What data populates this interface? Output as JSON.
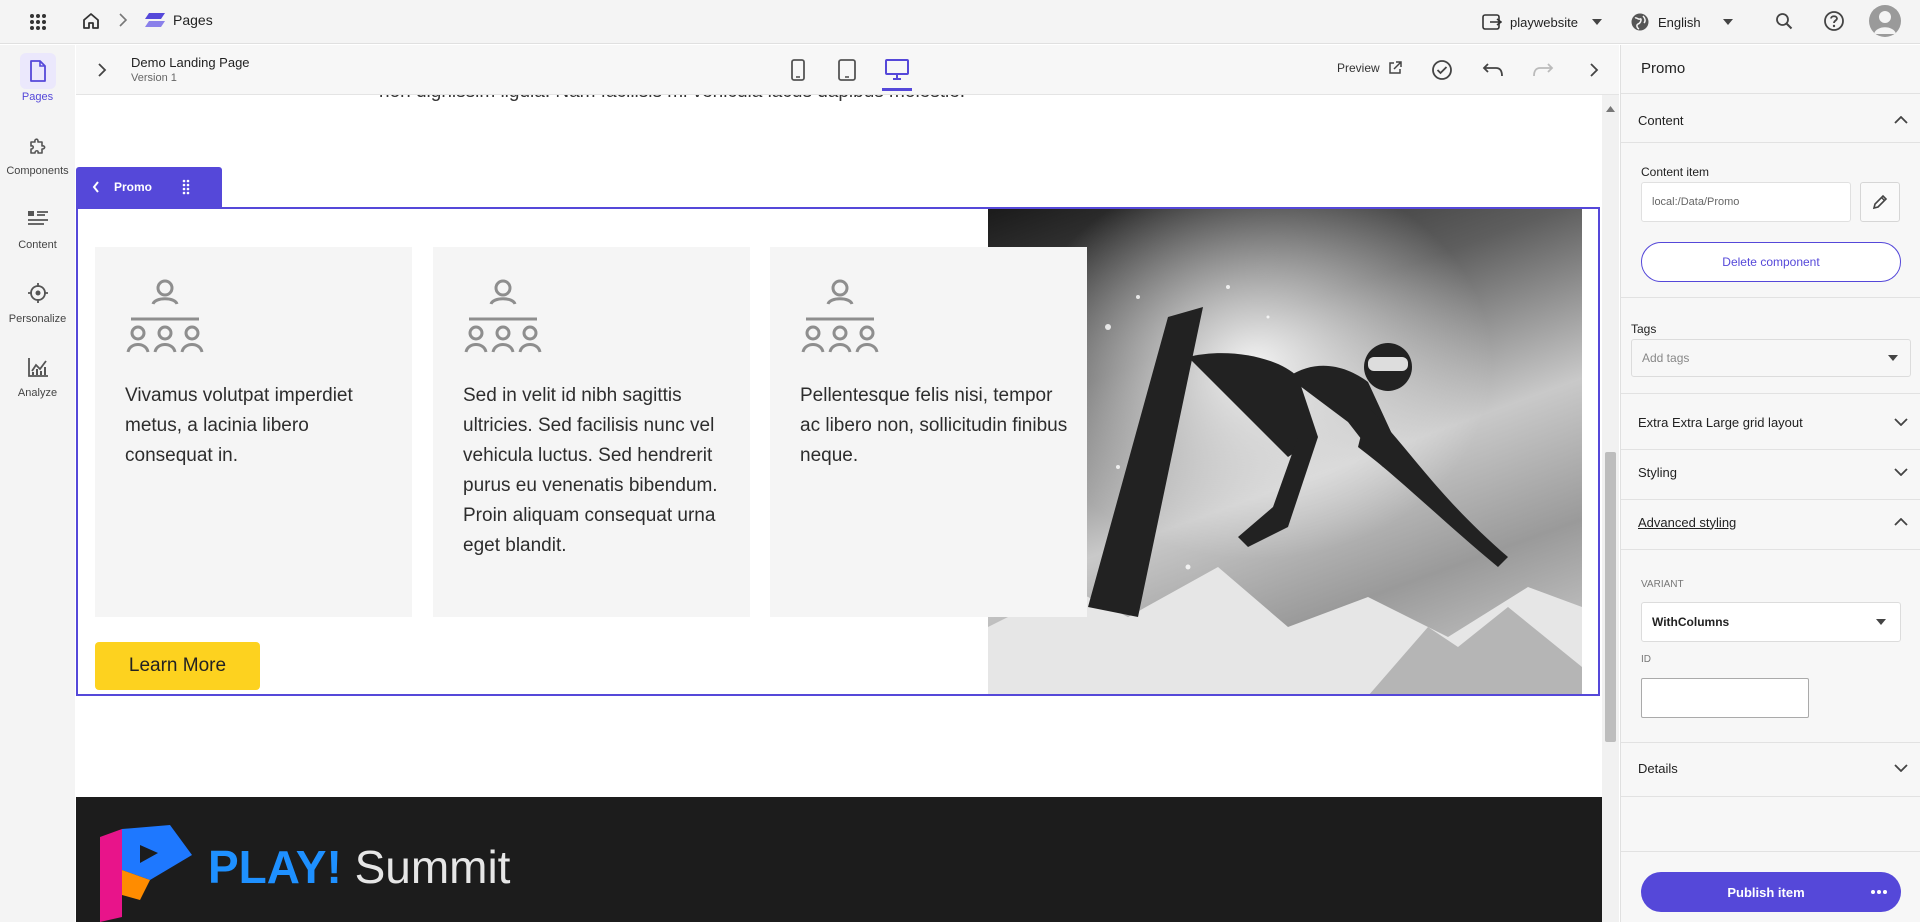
{
  "topbar": {
    "breadcrumb_app": "Pages",
    "site_name": "playwebsite",
    "language": "English"
  },
  "leftnav": {
    "items": [
      {
        "label": "Pages",
        "icon": "page-icon",
        "active": true
      },
      {
        "label": "Components",
        "icon": "puzzle-icon"
      },
      {
        "label": "Content",
        "icon": "content-list-icon"
      },
      {
        "label": "Personalize",
        "icon": "target-icon"
      },
      {
        "label": "Analyze",
        "icon": "analytics-icon"
      }
    ]
  },
  "editor": {
    "page_name": "Demo Landing Page",
    "version": "Version 1",
    "preview_label": "Preview",
    "active_device": "desktop"
  },
  "canvas": {
    "top_text": "non dignissim ligula. Nam facilisis mi vehicula lacus dapibus molestie.",
    "component_tab": "Promo",
    "cards": [
      {
        "text": "Vivamus volutpat imperdiet metus, a lacinia libero consequat in."
      },
      {
        "text": "Sed in velit id nibh sagittis ultricies. Sed facilisis nunc vel vehicula luctus. Sed hendrerit purus eu venenatis bibendum. Proin aliquam consequat urna eget blandit."
      },
      {
        "text": "Pellentesque felis nisi, tempor ac libero non, sollicitudin finibus neque."
      }
    ],
    "cta_label": "Learn More",
    "footer_brand_bold": "PLAY!",
    "footer_brand_light": "Summit"
  },
  "rightpanel": {
    "title": "Promo",
    "content_section": "Content",
    "content_item_label": "Content item",
    "content_item_value": "local:/Data/Promo",
    "delete_label": "Delete component",
    "tags_label": "Tags",
    "tags_placeholder": "Add tags",
    "grid_section": "Extra Extra Large grid layout",
    "styling_section": "Styling",
    "advanced_section": "Advanced styling",
    "variant_label": "VARIANT",
    "variant_value": "WithColumns",
    "id_label": "ID",
    "id_value": "",
    "details_section": "Details",
    "publish_label": "Publish item"
  },
  "colors": {
    "accent": "#5548d9",
    "cta": "#fdd21f",
    "footer_bg": "#1c1c1c",
    "brand_blue": "#1e90ff"
  }
}
